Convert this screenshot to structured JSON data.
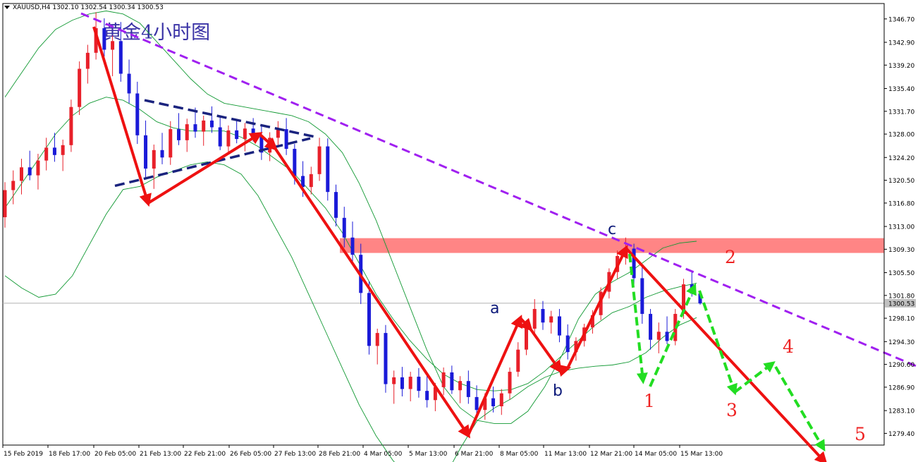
{
  "header": {
    "symbol_line": "XAUUSD,H4  1302.10 1302.54 1300.34 1300.53"
  },
  "chart_data": {
    "type": "candlestick",
    "title": "黄金4小时图",
    "symbol": "XAUUSD",
    "timeframe": "H4",
    "ohlc_header": {
      "open": 1302.1,
      "high": 1302.54,
      "low": 1300.34,
      "close": 1300.53
    },
    "current_price": "1300.53",
    "ylim": [
      1277.5,
      1349.2
    ],
    "yticks": [
      "1346.70",
      "1342.90",
      "1339.20",
      "1335.40",
      "1331.70",
      "1328.00",
      "1324.20",
      "1320.50",
      "1316.80",
      "1313.00",
      "1309.30",
      "1305.50",
      "1301.80",
      "1298.10",
      "1294.30",
      "1290.60",
      "1286.90",
      "1283.10",
      "1279.40"
    ],
    "xticks": [
      "15 Feb 2019",
      "18 Feb 17:00",
      "20 Feb 05:00",
      "21 Feb 13:00",
      "22 Feb 21:00",
      "26 Feb 05:00",
      "27 Feb 13:00",
      "28 Feb 21:00",
      "4 Mar 05:00",
      "5 Mar 13:00",
      "6 Mar 21:00",
      "8 Mar 05:00",
      "11 Mar 13:00",
      "12 Mar 21:00",
      "14 Mar 05:00",
      "15 Mar 13:00"
    ],
    "colors": {
      "bull": "#e8202a",
      "bear": "#1a1ad8",
      "bands": "#119933",
      "trend_purple": "#a020f0",
      "wave_red": "#ee1111",
      "forecast_green": "#22dd22",
      "triangle_navy": "#1a237e",
      "zone": "#ff7070",
      "label_navy": "#0d1a7a",
      "label_red": "#ee2222"
    },
    "resistance_zone": [
      1308.7,
      1311.1
    ],
    "trendline_resistance": [
      [
        "19 Feb 21:00",
        1347.6
      ],
      [
        "15 Mar 13:00",
        1305.8
      ],
      [
        "19 Mar 13:00",
        1290.0
      ]
    ],
    "wave_path": [
      [
        "20 Feb 01:00",
        1346.5
      ],
      [
        "21 Feb 17:00",
        1319.0
      ],
      [
        "26 Feb 09:00",
        1329.8
      ],
      [
        "27 Feb 05:00",
        1328.6
      ],
      [
        "6 Mar 21:00",
        1281.8
      ],
      [
        "8 Mar 09:00",
        1301.3
      ],
      [
        "8 Mar 21:00",
        1298.4
      ],
      [
        "11 Mar 13:00",
        1291.8
      ],
      [
        "12 Mar 01:00",
        1292.0
      ],
      [
        "13 Mar 09:00",
        1311.0
      ],
      [
        "19 Mar 13:00",
        1277.5
      ]
    ],
    "forecast_path": [
      [
        "13 Mar 09:00",
        1311.0
      ],
      [
        "14 Mar 05:00",
        1289.9
      ],
      [
        "15 Mar 09:00",
        1304.4
      ],
      [
        "18 Mar 09:00",
        1287.2
      ],
      [
        "18 Mar 21:00",
        1291.8
      ],
      [
        "19 Mar 21:00",
        1279.4
      ]
    ],
    "triangle_upper": [
      [
        1322.5,
        1333.5
      ],
      [
        1326.8,
        1327.6
      ]
    ],
    "labels": {
      "a": "a",
      "b": "b",
      "c": "c",
      "w1": "1",
      "w2": "2",
      "w3": "3",
      "w4": "4",
      "w5": "5"
    },
    "series": [
      {
        "name": "candles",
        "ohlc": [
          [
            1314.5,
            1320.2,
            1312.8,
            1318.9
          ],
          [
            1318.9,
            1322.1,
            1316.6,
            1320.4
          ],
          [
            1320.4,
            1324.0,
            1318.2,
            1322.6
          ],
          [
            1322.6,
            1325.3,
            1320.5,
            1321.3
          ],
          [
            1321.3,
            1324.8,
            1319.0,
            1323.7
          ],
          [
            1323.7,
            1327.4,
            1322.1,
            1325.8
          ],
          [
            1325.8,
            1328.2,
            1323.5,
            1324.6
          ],
          [
            1324.6,
            1327.1,
            1322.0,
            1326.2
          ],
          [
            1326.2,
            1333.6,
            1325.1,
            1332.4
          ],
          [
            1332.4,
            1339.8,
            1331.1,
            1338.6
          ],
          [
            1338.6,
            1342.5,
            1336.2,
            1341.2
          ],
          [
            1341.2,
            1347.8,
            1340.1,
            1345.2
          ],
          [
            1345.2,
            1346.8,
            1340.6,
            1341.7
          ],
          [
            1341.7,
            1344.0,
            1337.4,
            1343.1
          ],
          [
            1343.1,
            1346.2,
            1336.5,
            1337.8
          ],
          [
            1337.8,
            1340.1,
            1333.0,
            1334.6
          ],
          [
            1334.6,
            1336.5,
            1326.4,
            1327.8
          ],
          [
            1327.8,
            1330.2,
            1321.0,
            1322.4
          ],
          [
            1322.4,
            1326.3,
            1319.1,
            1325.4
          ],
          [
            1325.4,
            1328.2,
            1323.1,
            1324.2
          ],
          [
            1324.2,
            1330.1,
            1323.0,
            1328.8
          ],
          [
            1328.8,
            1331.4,
            1326.2,
            1327.0
          ],
          [
            1327.0,
            1330.5,
            1325.1,
            1329.6
          ],
          [
            1329.6,
            1332.3,
            1327.4,
            1328.4
          ],
          [
            1328.4,
            1331.0,
            1326.1,
            1330.2
          ],
          [
            1330.2,
            1332.5,
            1328.2,
            1329.1
          ],
          [
            1329.1,
            1330.8,
            1325.4,
            1326.0
          ],
          [
            1326.0,
            1329.4,
            1324.8,
            1328.6
          ],
          [
            1328.6,
            1330.4,
            1326.5,
            1327.2
          ],
          [
            1327.2,
            1329.8,
            1325.2,
            1328.9
          ],
          [
            1328.9,
            1330.6,
            1326.8,
            1327.6
          ],
          [
            1327.6,
            1329.6,
            1323.8,
            1325.0
          ],
          [
            1325.0,
            1328.3,
            1323.6,
            1327.4
          ],
          [
            1327.4,
            1330.1,
            1326.2,
            1328.8
          ],
          [
            1328.8,
            1330.6,
            1324.6,
            1325.6
          ],
          [
            1325.6,
            1326.4,
            1319.8,
            1321.2
          ],
          [
            1321.2,
            1323.6,
            1317.8,
            1319.4
          ],
          [
            1319.4,
            1322.7,
            1318.2,
            1321.5
          ],
          [
            1321.5,
            1327.4,
            1320.4,
            1326.0
          ],
          [
            1326.0,
            1327.3,
            1317.2,
            1318.6
          ],
          [
            1318.6,
            1319.8,
            1313.0,
            1314.4
          ],
          [
            1314.4,
            1316.2,
            1309.6,
            1311.2
          ],
          [
            1311.2,
            1313.8,
            1306.8,
            1308.4
          ],
          [
            1308.4,
            1310.2,
            1300.4,
            1302.2
          ],
          [
            1302.2,
            1304.1,
            1292.2,
            1293.6
          ],
          [
            1293.6,
            1296.4,
            1290.6,
            1295.7
          ],
          [
            1295.7,
            1297.0,
            1286.0,
            1287.4
          ],
          [
            1287.4,
            1289.6,
            1284.2,
            1288.5
          ],
          [
            1288.5,
            1290.2,
            1285.4,
            1286.6
          ],
          [
            1286.6,
            1289.4,
            1284.6,
            1288.6
          ],
          [
            1288.6,
            1290.0,
            1285.2,
            1286.3
          ],
          [
            1286.3,
            1288.8,
            1283.6,
            1284.8
          ],
          [
            1284.8,
            1287.6,
            1283.0,
            1286.9
          ],
          [
            1286.9,
            1290.1,
            1285.6,
            1289.3
          ],
          [
            1289.3,
            1290.4,
            1285.8,
            1286.4
          ],
          [
            1286.4,
            1288.7,
            1284.3,
            1287.9
          ],
          [
            1287.9,
            1289.6,
            1284.2,
            1285.3
          ],
          [
            1285.3,
            1287.2,
            1282.4,
            1283.2
          ],
          [
            1283.2,
            1285.9,
            1281.6,
            1285.1
          ],
          [
            1285.1,
            1287.0,
            1282.8,
            1283.8
          ],
          [
            1283.8,
            1286.6,
            1282.4,
            1285.9
          ],
          [
            1285.9,
            1290.1,
            1284.9,
            1289.4
          ],
          [
            1289.4,
            1294.2,
            1288.6,
            1293.0
          ],
          [
            1293.0,
            1297.3,
            1292.1,
            1296.4
          ],
          [
            1296.4,
            1301.2,
            1295.2,
            1299.6
          ],
          [
            1299.6,
            1300.9,
            1296.2,
            1297.4
          ],
          [
            1297.4,
            1299.3,
            1295.6,
            1298.4
          ],
          [
            1298.4,
            1299.6,
            1294.2,
            1295.3
          ],
          [
            1295.3,
            1297.1,
            1291.4,
            1292.6
          ],
          [
            1292.6,
            1295.0,
            1291.2,
            1294.4
          ],
          [
            1294.4,
            1297.2,
            1293.5,
            1296.6
          ],
          [
            1296.6,
            1299.4,
            1295.6,
            1298.6
          ],
          [
            1298.6,
            1303.1,
            1297.8,
            1302.4
          ],
          [
            1302.4,
            1306.2,
            1301.3,
            1305.6
          ],
          [
            1305.6,
            1309.1,
            1304.5,
            1308.2
          ],
          [
            1308.2,
            1311.2,
            1306.8,
            1309.4
          ],
          [
            1309.4,
            1310.2,
            1303.6,
            1304.6
          ],
          [
            1304.6,
            1306.4,
            1297.2,
            1298.8
          ],
          [
            1298.8,
            1299.6,
            1293.0,
            1294.6
          ],
          [
            1294.6,
            1297.4,
            1292.4,
            1295.9
          ],
          [
            1295.9,
            1298.4,
            1293.9,
            1294.4
          ],
          [
            1294.4,
            1299.6,
            1293.7,
            1298.8
          ],
          [
            1298.8,
            1304.5,
            1298.0,
            1303.6
          ],
          [
            1303.6,
            1305.6,
            1301.6,
            1302.1
          ],
          [
            1302.1,
            1302.5,
            1300.3,
            1300.5
          ]
        ]
      },
      {
        "name": "bollinger_upper",
        "values": [
          1334,
          1338,
          1342,
          1345,
          1346.5,
          1347.5,
          1348,
          1347.5,
          1346,
          1343,
          1340,
          1337,
          1334.5,
          1333,
          1332.5,
          1332,
          1331.5,
          1331,
          1330,
          1328,
          1325,
          1320,
          1314,
          1307,
          1300,
          1293,
          1287,
          1283.5,
          1281.5,
          1281,
          1281,
          1283,
          1287,
          1292,
          1298,
          1302,
          1304,
          1305.5,
          1307.5,
          1309.5,
          1310.3,
          1310.6
        ]
      },
      {
        "name": "bollinger_middle",
        "values": [
          1316,
          1320,
          1324,
          1328,
          1331,
          1333,
          1334,
          1333.5,
          1332,
          1330,
          1329,
          1328.5,
          1328.5,
          1328.5,
          1327.5,
          1326,
          1324,
          1322,
          1319,
          1316,
          1312,
          1307,
          1302,
          1298,
          1294.5,
          1291.5,
          1289,
          1287.5,
          1286.5,
          1286.3,
          1286.5,
          1287.5,
          1289.5,
          1292,
          1294.5,
          1297,
          1299,
          1300,
          1301.5,
          1302.5,
          1303.2,
          1303.8
        ]
      },
      {
        "name": "bollinger_lower",
        "values": [
          1305,
          1303,
          1301.5,
          1302,
          1305,
          1310,
          1315,
          1319,
          1319.5,
          1321,
          1322,
          1323,
          1323.5,
          1323,
          1321.5,
          1318,
          1313,
          1308,
          1302,
          1296,
          1290,
          1284,
          1279,
          1275,
          1272,
          1271.5,
          1272,
          1277,
          1281.5,
          1283.5,
          1285,
          1287,
          1288.5,
          1289.5,
          1290,
          1290.3,
          1290.5,
          1291,
          1292.5,
          1295,
          1297,
          1298.2
        ]
      }
    ]
  }
}
